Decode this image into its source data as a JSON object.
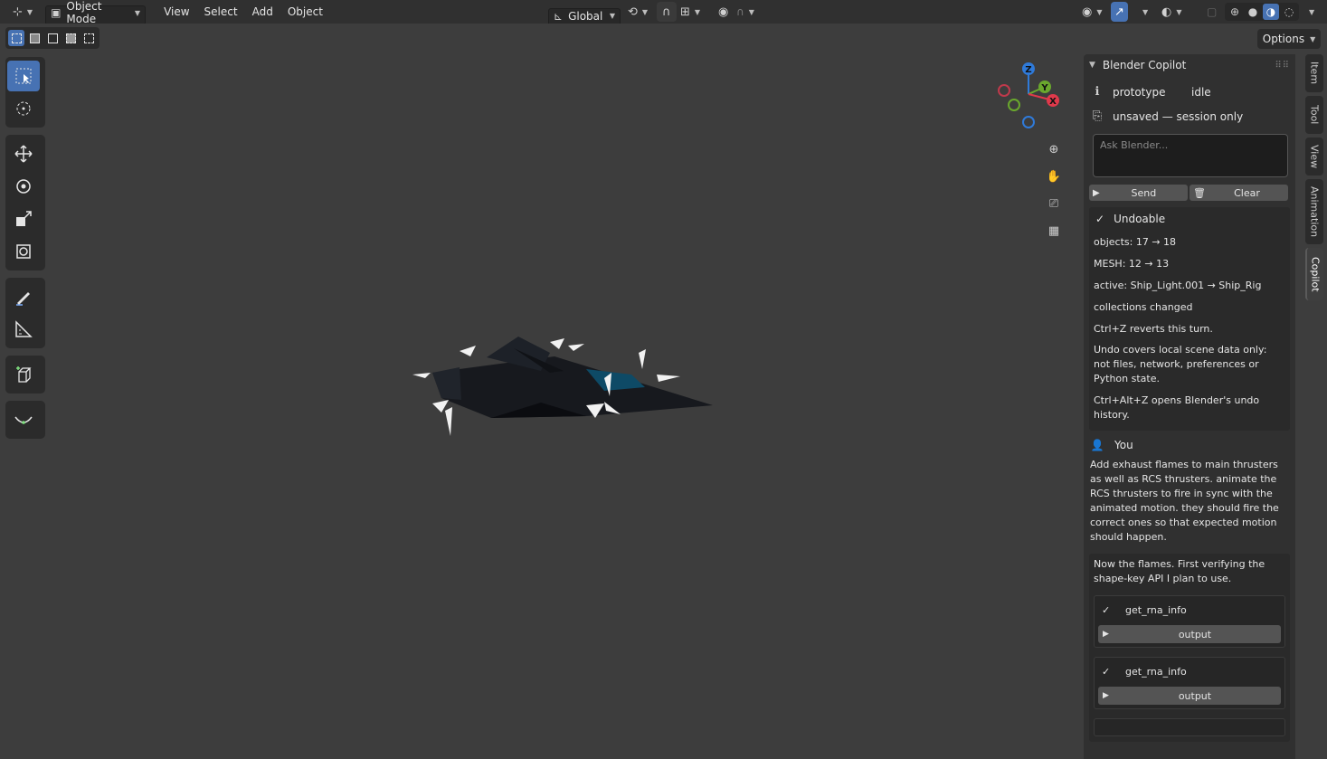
{
  "header": {
    "editor_type_icon": "axes-editor-icon",
    "mode": "Object Mode",
    "menus": [
      "View",
      "Select",
      "Add",
      "Object"
    ],
    "transform_orientation": "Global"
  },
  "subbar": {
    "options_label": "Options"
  },
  "toolbar": {
    "tools": [
      "select-box-icon",
      "cursor-icon",
      "move-icon",
      "rotate-icon",
      "scale-icon",
      "transform-icon",
      "annotate-icon",
      "measure-icon",
      "add-cube-icon",
      "curve-icon"
    ]
  },
  "gizmo": {
    "x": "X",
    "y": "Y",
    "z": "Z"
  },
  "panel": {
    "title": "Blender Copilot",
    "status_name": "prototype",
    "status_state": "idle",
    "save_state": "unsaved — session only",
    "input_placeholder": "Ask Blender...",
    "send_label": "Send",
    "clear_label": "Clear",
    "undo": {
      "title": "Undoable",
      "lines": [
        "objects: 17 → 18",
        "MESH: 12 → 13",
        "active: Ship_Light.001 → Ship_Rig",
        "collections changed",
        "Ctrl+Z reverts this turn."
      ],
      "note1": "Undo covers local scene data only: not files, network, preferences or Python state.",
      "note2": "Ctrl+Alt+Z opens Blender's undo history."
    },
    "user_label": "You",
    "user_message": "Add exhaust flames to main thrusters as well as RCS thrusters. animate the RCS thrusters to fire in sync with the animated motion. they should fire the correct ones so that expected motion should happen.",
    "assistant_message": "Now the flames. First verifying the shape-key API I plan to use.",
    "tool_calls": [
      {
        "name": "get_rna_info",
        "output_label": "output"
      },
      {
        "name": "get_rna_info",
        "output_label": "output"
      }
    ]
  },
  "tabs": [
    "Item",
    "Tool",
    "View",
    "Animation",
    "Copilot"
  ],
  "colors": {
    "accent": "#4772b3",
    "axis_x": "#e0394b",
    "axis_y": "#6aa82d",
    "axis_z": "#2f7ad9"
  }
}
